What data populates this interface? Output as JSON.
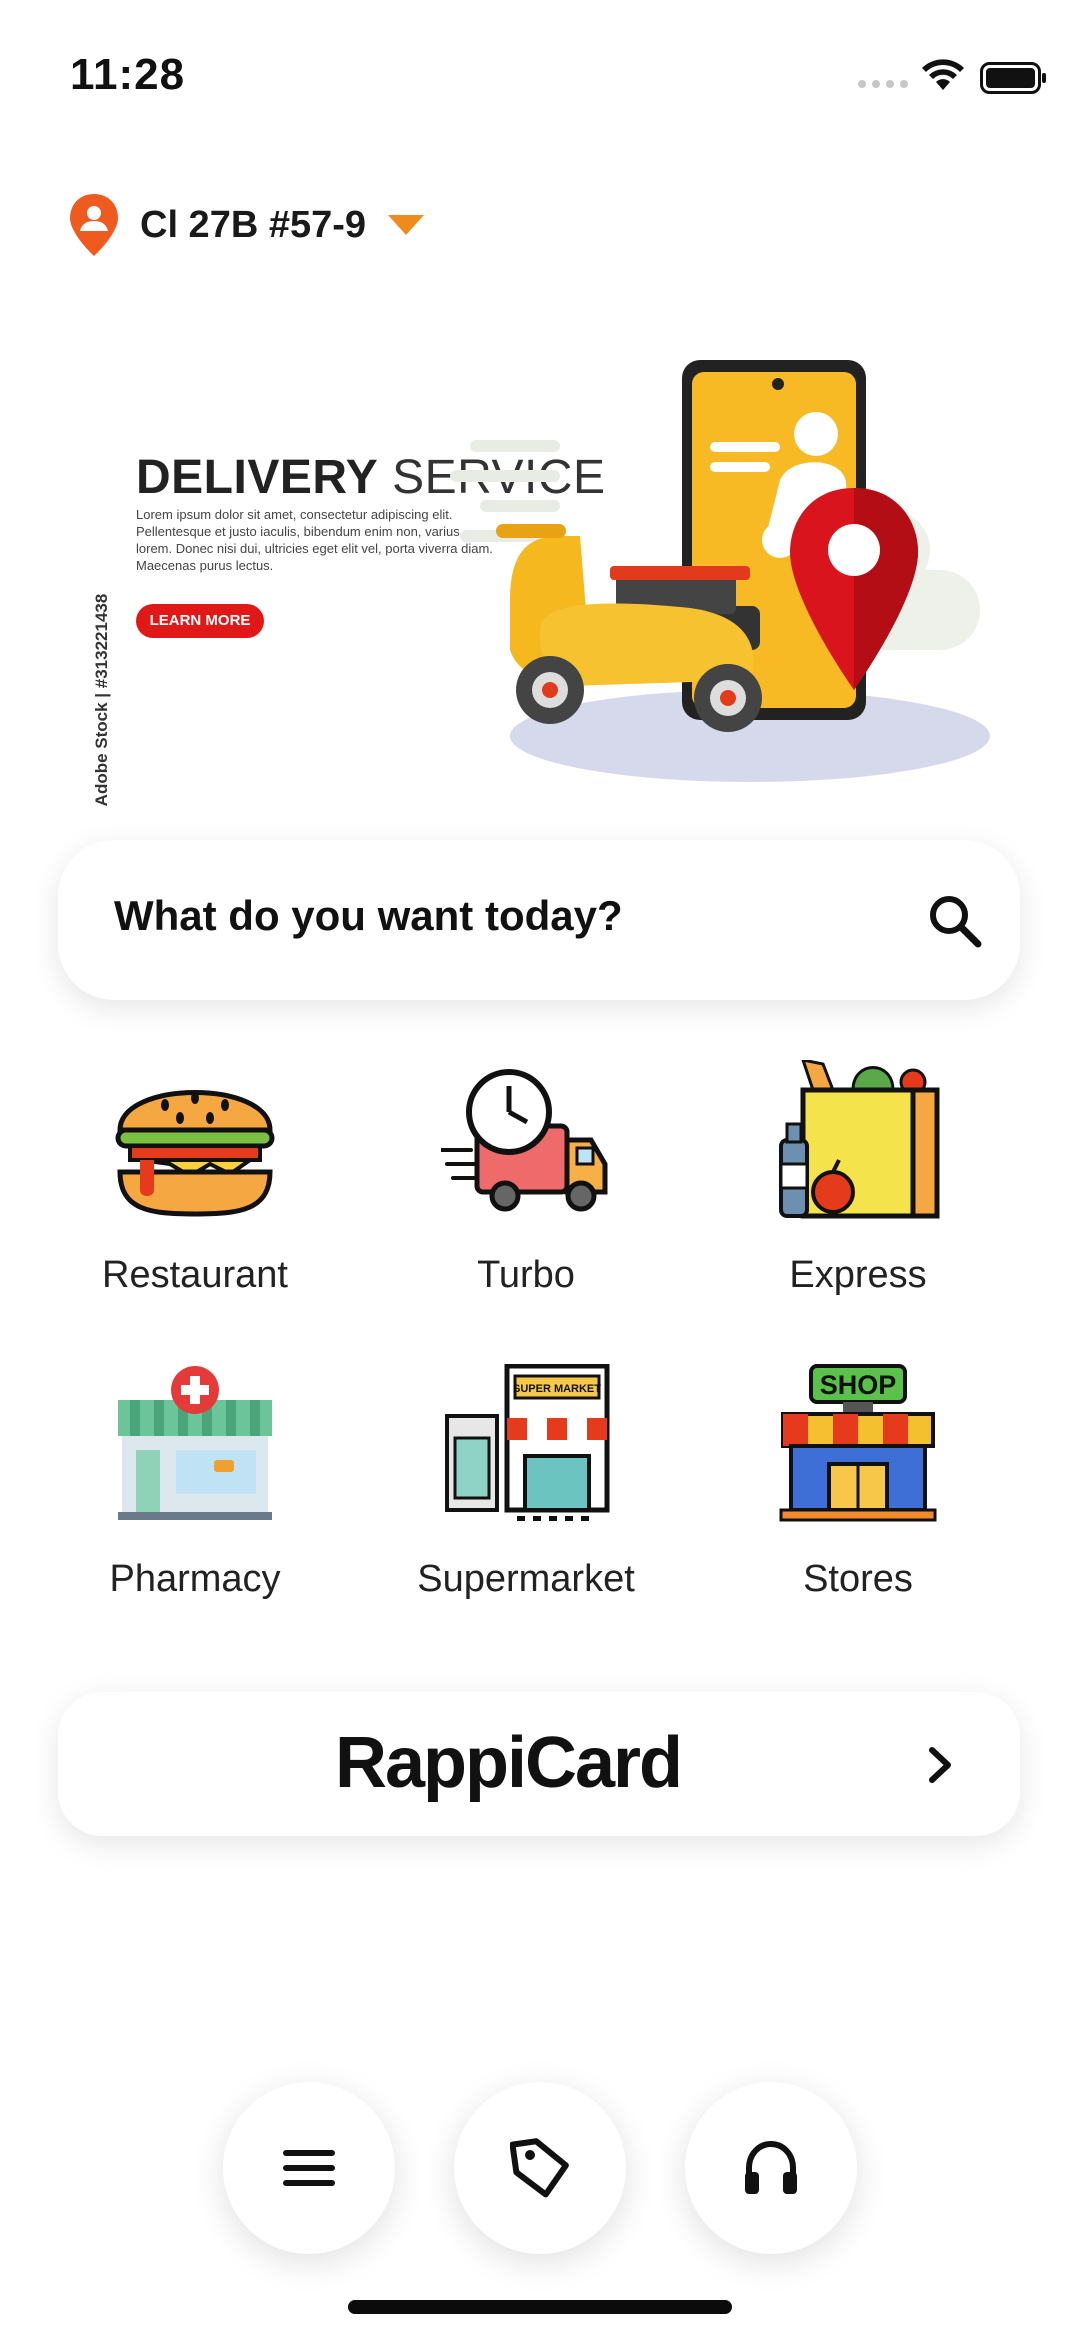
{
  "status_bar": {
    "time": "11:28"
  },
  "location": {
    "address": "Cl 27B #57-9"
  },
  "banner": {
    "title_bold": "DELIVERY",
    "title_light": "SERVICE",
    "body": "Lorem ipsum dolor sit amet, consectetur adipiscing elit. Pellentesque et justo iaculis, bibendum enim non, varius lorem. Donec nisi dui, ultricies eget elit vel, porta viverra diam. Maecenas purus lectus.",
    "button_label": "LEARN MORE",
    "credit": "Adobe Stock | #313221438"
  },
  "search": {
    "placeholder": "What do you want today?"
  },
  "categories": [
    {
      "label": "Restaurant",
      "icon": "burger-icon"
    },
    {
      "label": "Turbo",
      "icon": "delivery-truck-clock-icon"
    },
    {
      "label": "Express",
      "icon": "grocery-bag-icon"
    },
    {
      "label": "Pharmacy",
      "icon": "pharmacy-store-icon"
    },
    {
      "label": "Supermarket",
      "icon": "supermarket-icon"
    },
    {
      "label": "Stores",
      "icon": "shop-icon"
    }
  ],
  "rappicard": {
    "label": "RappiCard"
  },
  "bottom_nav": [
    {
      "icon": "menu-icon"
    },
    {
      "icon": "tag-icon"
    },
    {
      "icon": "headphones-icon"
    }
  ],
  "colors": {
    "accent": "#f08a1c",
    "pin": "#ef5a1e",
    "brand_red": "#e01818"
  }
}
